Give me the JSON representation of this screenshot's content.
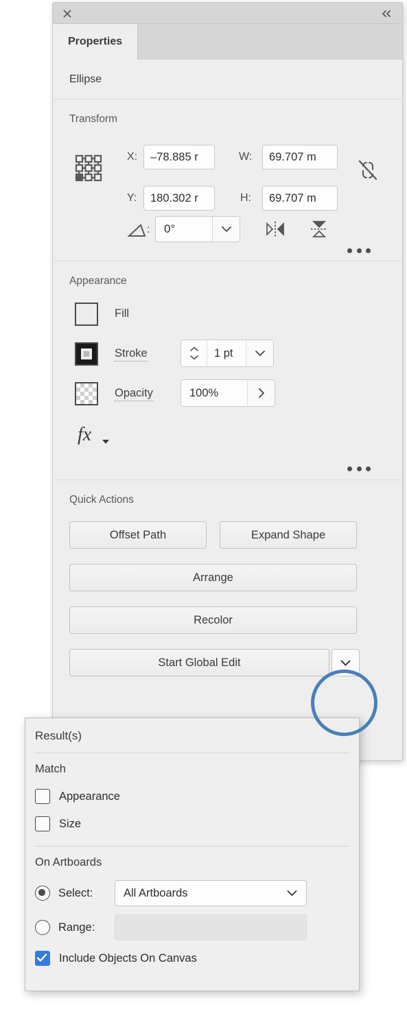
{
  "colors": {
    "panel_bg": "#eeeeee",
    "titlebar_bg": "#d6d6d6",
    "accent_blue": "#2f7de1",
    "highlight_ring": "#4a80b8",
    "text": "#3a3a3a"
  },
  "panel": {
    "titlebar": {
      "close_icon": "close-icon",
      "collapse_icon": "double-chevron-left-icon"
    },
    "tabs": [
      {
        "label": "Properties",
        "active": true
      }
    ],
    "object_name": "Ellipse"
  },
  "transform": {
    "title": "Transform",
    "reference_point_icon": "reference-point-grid-icon",
    "x_label": "X:",
    "x_value": "–78.885 r",
    "y_label": "Y:",
    "y_value": "180.302 r",
    "w_label": "W:",
    "w_value": "69.707 m",
    "h_label": "H:",
    "h_value": "69.707 m",
    "link_icon": "broken-link-icon",
    "angle_icon": "angle-icon",
    "angle_colon": ":",
    "angle_value": "0°",
    "angle_dropdown_icon": "chevron-down-icon",
    "flip_horizontal_icon": "flip-horizontal-icon",
    "flip_vertical_icon": "flip-vertical-icon",
    "more_options_icon": "ellipsis-icon"
  },
  "appearance": {
    "title": "Appearance",
    "fill_label": "Fill",
    "fill_swatch_icon": "fill-swatch-icon",
    "stroke_label": "Stroke",
    "stroke_swatch_icon": "stroke-swatch-icon",
    "stroke_value": "1 pt",
    "stroke_stepper_icon": "stepper-up-down-icon",
    "stroke_dropdown_icon": "chevron-down-icon",
    "opacity_label": "Opacity",
    "opacity_swatch_icon": "opacity-checkerboard-icon",
    "opacity_value": "100%",
    "opacity_arrow_icon": "chevron-right-icon",
    "fx_label": "fx",
    "fx_icon": "effects-fx-icon",
    "more_options_icon": "ellipsis-icon"
  },
  "quick_actions": {
    "title": "Quick Actions",
    "offset_path": "Offset Path",
    "expand_shape": "Expand Shape",
    "arrange": "Arrange",
    "recolor": "Recolor",
    "start_global_edit": "Start Global Edit",
    "global_edit_dropdown_icon": "chevron-down-icon"
  },
  "results_popup": {
    "title": "Result(s)",
    "match_section": {
      "label": "Match",
      "options": [
        {
          "label": "Appearance",
          "checked": false
        },
        {
          "label": "Size",
          "checked": false
        }
      ]
    },
    "artboards_section": {
      "label": "On Artboards",
      "select_radio_label": "Select:",
      "select_radio_selected": true,
      "select_value": "All Artboards",
      "select_caret_icon": "chevron-down-icon",
      "range_radio_label": "Range:",
      "range_radio_selected": false,
      "range_value": "",
      "include_canvas_label": "Include Objects On Canvas",
      "include_canvas_checked": true
    }
  }
}
